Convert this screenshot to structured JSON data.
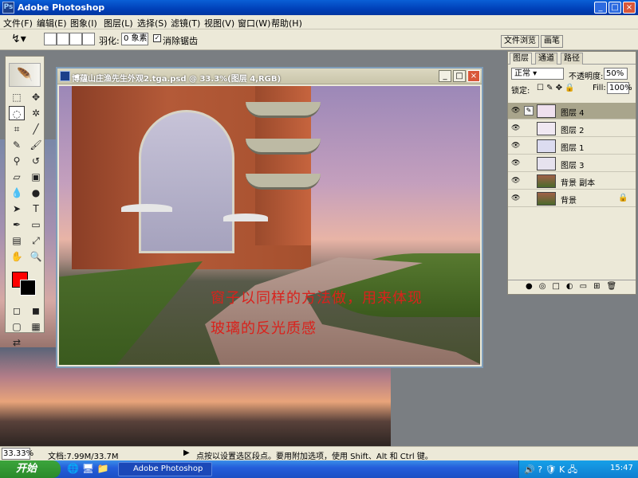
{
  "app": {
    "title": "Adobe Photoshop"
  },
  "menu": [
    "文件(F)",
    "编辑(E)",
    "图象(I)",
    "图层(L)",
    "选择(S)",
    "滤镜(T)",
    "视图(V)",
    "窗口(W)",
    "帮助(H)"
  ],
  "options": {
    "feather_label": "羽化:",
    "feather_value": "0 象素",
    "antialias_label": "消除锯齿"
  },
  "panel_tabs": {
    "file_browser": "文件浏览",
    "brushes": "画笔"
  },
  "document": {
    "title": "博蕴山庄渔先生外观2.tga.psd @ 33.3%(图层 4,RGB)",
    "overlay_line1": "窗子以同样的方法做，用来体现",
    "overlay_line2": "玻璃的反光质感"
  },
  "layers_panel": {
    "tabs": [
      "图层",
      "通道",
      "路径"
    ],
    "blend_mode": "正常",
    "opacity_label": "不透明度:",
    "opacity_value": "50%",
    "lock_label": "锁定:",
    "fill_label": "Fill:",
    "fill_value": "100%",
    "layers": [
      {
        "name": "图层 4",
        "selected": true
      },
      {
        "name": "图层 2",
        "selected": false
      },
      {
        "name": "图层 1",
        "selected": false
      },
      {
        "name": "图层 3",
        "selected": false
      },
      {
        "name": "背景 副本",
        "selected": false
      },
      {
        "name": "背景",
        "selected": false
      }
    ]
  },
  "status": {
    "zoom": "33.33%",
    "doc_size": "文档:7.99M/33.7M",
    "hint": "点按以设置选区段点。要用附加选项，使用 Shift、Alt 和 Ctrl 键。"
  },
  "taskbar": {
    "start": "开始",
    "task_label": "Adobe Photoshop",
    "clock": "15:47"
  },
  "colors": {
    "foreground": "#ff0000",
    "background": "#000000"
  }
}
